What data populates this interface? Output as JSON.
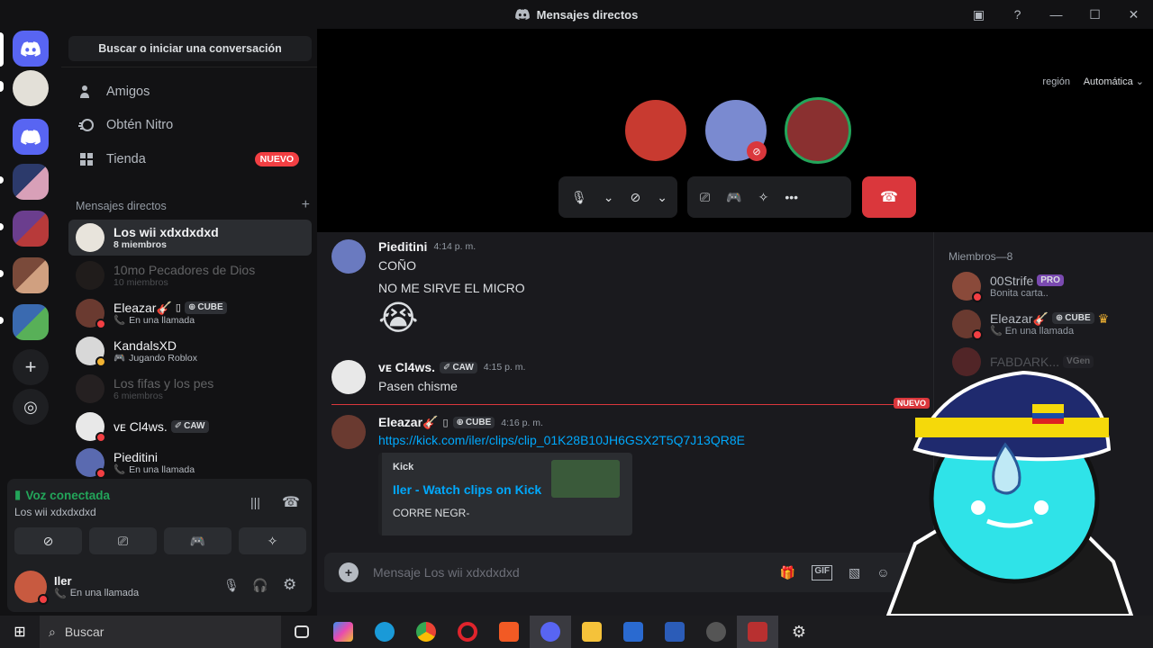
{
  "window": {
    "title": "Mensajes directos"
  },
  "dm_sidebar": {
    "search_label": "Buscar o iniciar una conversación",
    "nav": [
      {
        "label": "Amigos"
      },
      {
        "label": "Obtén Nitro"
      },
      {
        "label": "Tienda",
        "badge": "NUEVO"
      }
    ],
    "section_label": "Mensajes directos",
    "dms": [
      {
        "name": "Los wii xdxdxdxd",
        "sub": "8 miembros"
      },
      {
        "name": "10mo Pecadores de Dios",
        "sub": "10 miembros"
      },
      {
        "name": "Eleazar🎸",
        "tag": "CUBE",
        "sub": "En una llamada"
      },
      {
        "name": "KandalsXD",
        "sub": "Jugando Roblox"
      },
      {
        "name": "Los fifas y los pes",
        "sub": "6 miembros"
      },
      {
        "name": "ᴠᴇ Cl4ws.",
        "tag": "CAW"
      },
      {
        "name": "Pieditini",
        "sub": "En una llamada"
      }
    ]
  },
  "voice": {
    "status": "Voz conectada",
    "channel": "Los wii xdxdxdxd"
  },
  "user": {
    "name": "Iler",
    "status": "En una llamada"
  },
  "call": {
    "region_label": "región",
    "region_value": "Automática"
  },
  "messages": [
    {
      "author": "Pieditini",
      "time": "4:14 p. m.",
      "lines": [
        "COÑO",
        "NO ME SIRVE EL MICRO"
      ],
      "emoji": "😭"
    },
    {
      "author": "ᴠᴇ Cl4ws.",
      "tag": "CAW",
      "time": "4:15 p. m.",
      "lines": [
        "Pasen chisme"
      ]
    },
    {
      "author": "Eleazar🎸",
      "tag": "CUBE",
      "time": "4:16 p. m.",
      "link": "https://kick.com/iler/clips/clip_01K28B10JH6GSX2T5Q7J13QR8E",
      "embed": {
        "provider": "Kick",
        "title": "Iler - Watch clips on Kick",
        "desc": "CORRE NEGR-"
      }
    }
  ],
  "new_divider": "NUEVO",
  "composer": {
    "placeholder": "Mensaje Los wii xdxdxdxd"
  },
  "members": {
    "header": "Miembros—8",
    "list": [
      {
        "name": "00Strife",
        "tag": "PRO",
        "sub": "Bonita carta.."
      },
      {
        "name": "Eleazar🎸",
        "tag": "CUBE",
        "sub": "En una llamada"
      },
      {
        "name": "FABDARK...",
        "tag": "VGen"
      }
    ]
  },
  "taskbar": {
    "search_label": "Buscar"
  },
  "colors": {
    "accent": "#5865f2",
    "danger": "#da373c",
    "online": "#23a55a",
    "link": "#00a8fc"
  }
}
